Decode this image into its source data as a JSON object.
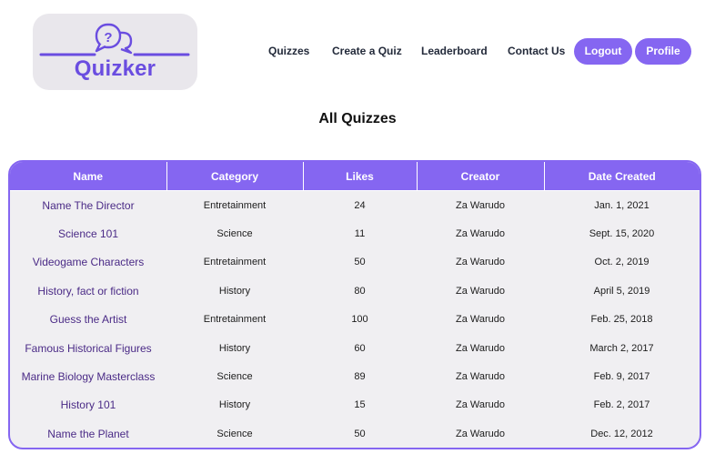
{
  "brand": {
    "name": "Quizker",
    "icon": "question-speech-bubbles-icon",
    "color": "#6a4de0"
  },
  "nav": {
    "links": [
      {
        "label": "Quizzes"
      },
      {
        "label": "Create a Quiz"
      },
      {
        "label": "Leaderboard"
      },
      {
        "label": "Contact Us"
      }
    ],
    "logout_label": "Logout",
    "profile_label": "Profile"
  },
  "page": {
    "title": "All Quizzes"
  },
  "colors": {
    "accent": "#8566f1",
    "table_bg": "#f0eff2",
    "link": "#4a2a86"
  },
  "table": {
    "columns": [
      "Name",
      "Category",
      "Likes",
      "Creator",
      "Date Created"
    ],
    "rows": [
      {
        "name": "Name The Director",
        "category": "Entretainment",
        "likes": "24",
        "creator": "Za Warudo",
        "date": "Jan. 1, 2021"
      },
      {
        "name": "Science 101",
        "category": "Science",
        "likes": "11",
        "creator": "Za Warudo",
        "date": "Sept. 15, 2020"
      },
      {
        "name": "Videogame Characters",
        "category": "Entretainment",
        "likes": "50",
        "creator": "Za Warudo",
        "date": "Oct. 2, 2019"
      },
      {
        "name": "History, fact or fiction",
        "category": "History",
        "likes": "80",
        "creator": "Za Warudo",
        "date": "April 5, 2019"
      },
      {
        "name": "Guess the Artist",
        "category": "Entretainment",
        "likes": "100",
        "creator": "Za Warudo",
        "date": "Feb. 25, 2018"
      },
      {
        "name": "Famous Historical Figures",
        "category": "History",
        "likes": "60",
        "creator": "Za Warudo",
        "date": "March 2, 2017"
      },
      {
        "name": "Marine Biology Masterclass",
        "category": "Science",
        "likes": "89",
        "creator": "Za Warudo",
        "date": "Feb. 9, 2017"
      },
      {
        "name": "History 101",
        "category": "History",
        "likes": "15",
        "creator": "Za Warudo",
        "date": "Feb. 2, 2017"
      },
      {
        "name": "Name the Planet",
        "category": "Science",
        "likes": "50",
        "creator": "Za Warudo",
        "date": "Dec. 12, 2012"
      }
    ]
  }
}
